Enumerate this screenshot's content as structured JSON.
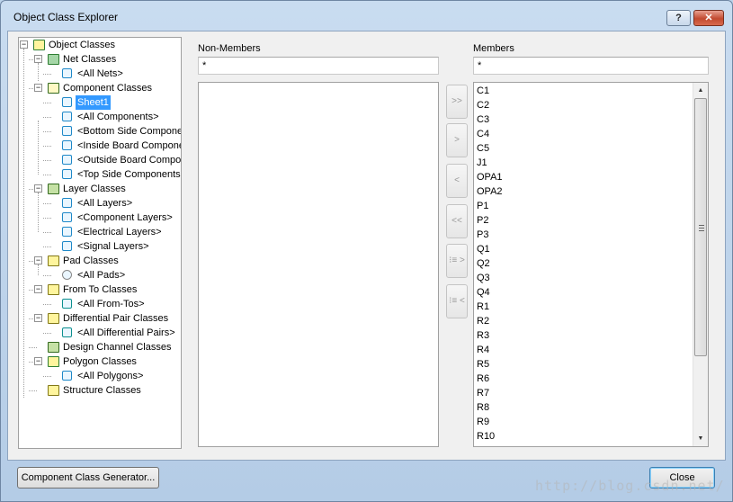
{
  "window": {
    "title": "Object Class Explorer",
    "help_label": "?",
    "close_label": "✕"
  },
  "tree": {
    "items": [
      {
        "label": "Object Classes",
        "icon": "object-classes-icon",
        "level": 0,
        "expander": "-"
      },
      {
        "label": "Net Classes",
        "icon": "net-classes-icon",
        "level": 1,
        "expander": "-"
      },
      {
        "label": "<All Nets>",
        "icon": "net-icon",
        "level": 2,
        "expander": ""
      },
      {
        "label": "Component Classes",
        "icon": "component-classes-icon",
        "level": 1,
        "expander": "-"
      },
      {
        "label": "Sheet1",
        "icon": "component-icon",
        "level": 2,
        "expander": "",
        "selected": true
      },
      {
        "label": "<All Components>",
        "icon": "component-icon",
        "level": 2,
        "expander": ""
      },
      {
        "label": "<Bottom Side Componer",
        "icon": "component-icon",
        "level": 2,
        "expander": ""
      },
      {
        "label": "<Inside Board Compone",
        "icon": "component-icon",
        "level": 2,
        "expander": ""
      },
      {
        "label": "<Outside Board Compor",
        "icon": "component-icon",
        "level": 2,
        "expander": ""
      },
      {
        "label": "<Top Side Components:",
        "icon": "component-icon",
        "level": 2,
        "expander": ""
      },
      {
        "label": "Layer Classes",
        "icon": "layer-classes-icon",
        "level": 1,
        "expander": "-"
      },
      {
        "label": "<All Layers>",
        "icon": "layer-icon",
        "level": 2,
        "expander": ""
      },
      {
        "label": "<Component Layers>",
        "icon": "layer-icon",
        "level": 2,
        "expander": ""
      },
      {
        "label": "<Electrical Layers>",
        "icon": "layer-icon",
        "level": 2,
        "expander": ""
      },
      {
        "label": "<Signal Layers>",
        "icon": "layer-icon",
        "level": 2,
        "expander": ""
      },
      {
        "label": "Pad Classes",
        "icon": "pad-classes-icon",
        "level": 1,
        "expander": "-"
      },
      {
        "label": "<All Pads>",
        "icon": "pad-icon",
        "level": 2,
        "expander": ""
      },
      {
        "label": "From To Classes",
        "icon": "from-to-classes-icon",
        "level": 1,
        "expander": "-"
      },
      {
        "label": "<All From-Tos>",
        "icon": "from-to-icon",
        "level": 2,
        "expander": ""
      },
      {
        "label": "Differential Pair Classes",
        "icon": "diff-pair-classes-icon",
        "level": 1,
        "expander": "-"
      },
      {
        "label": "<All Differential Pairs>",
        "icon": "diff-pair-icon",
        "level": 2,
        "expander": ""
      },
      {
        "label": "Design Channel Classes",
        "icon": "design-channel-classes-icon",
        "level": 1,
        "expander": ""
      },
      {
        "label": "Polygon Classes",
        "icon": "polygon-classes-icon",
        "level": 1,
        "expander": "-"
      },
      {
        "label": "<All Polygons>",
        "icon": "polygon-icon",
        "level": 2,
        "expander": ""
      },
      {
        "label": "Structure Classes",
        "icon": "structure-classes-icon",
        "level": 1,
        "expander": ""
      }
    ]
  },
  "non_members": {
    "label": "Non-Members",
    "filter_value": "*"
  },
  "members": {
    "label": "Members",
    "filter_value": "*",
    "items": [
      "C1",
      "C2",
      "C3",
      "C4",
      "C5",
      "J1",
      "OPA1",
      "OPA2",
      "P1",
      "P2",
      "P3",
      "Q1",
      "Q2",
      "Q3",
      "Q4",
      "R1",
      "R2",
      "R3",
      "R4",
      "R5",
      "R6",
      "R7",
      "R8",
      "R9",
      "R10"
    ]
  },
  "transfer_buttons": [
    {
      "name": "add-all-button",
      "label": ">>"
    },
    {
      "name": "add-selected-button",
      "label": ">"
    },
    {
      "name": "remove-selected-button",
      "label": "<"
    },
    {
      "name": "remove-all-button",
      "label": "<<"
    },
    {
      "name": "add-filtered-button",
      "label": "⁝≡ >"
    },
    {
      "name": "remove-filtered-button",
      "label": "⁝≡ <"
    }
  ],
  "buttons": {
    "generator": "Component Class Generator...",
    "close": "Close"
  },
  "watermark": "http://blog.csdn.net/"
}
